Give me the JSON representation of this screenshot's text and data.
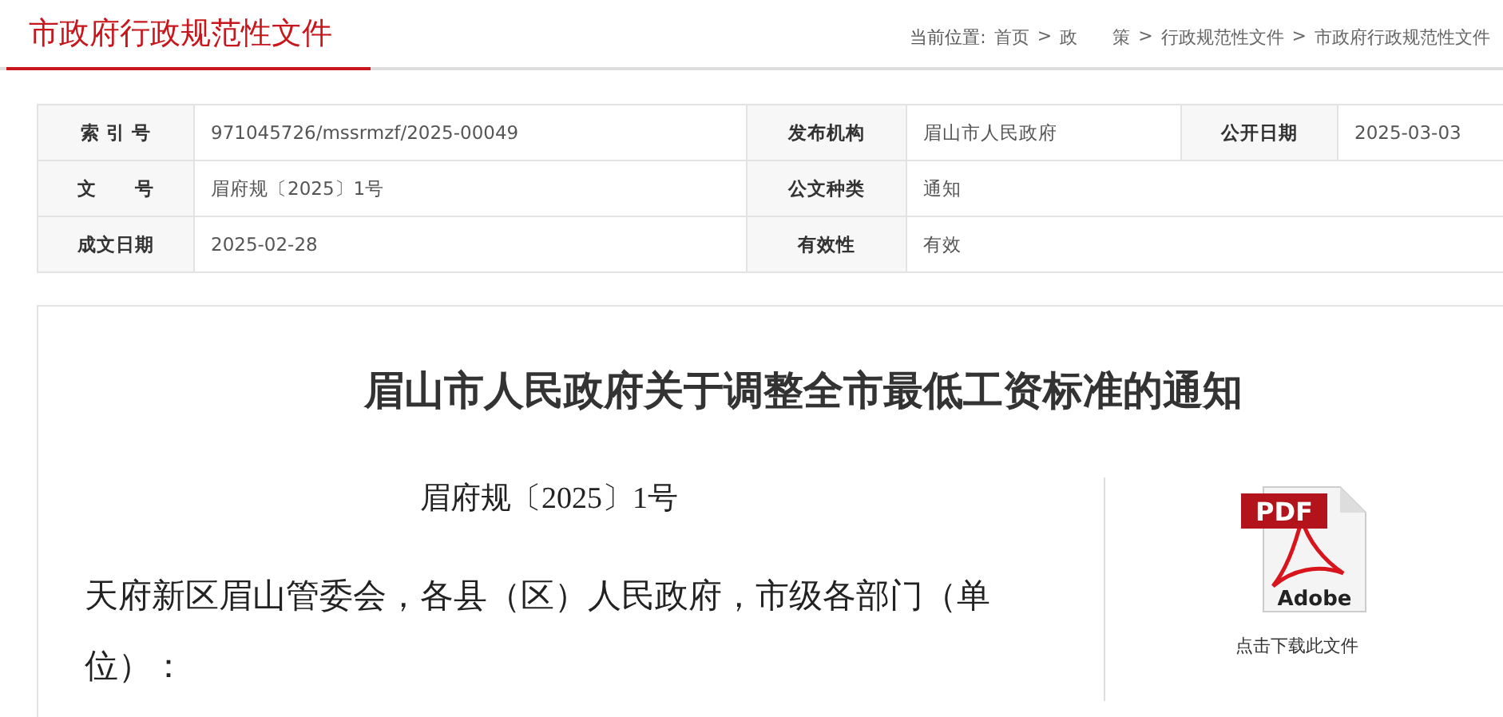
{
  "header": {
    "title": "市政府行政规范性文件",
    "breadcrumb": {
      "prefix": "当前位置:",
      "items": [
        "首页",
        "政　　策",
        "行政规范性文件",
        "市政府行政规范性文件"
      ],
      "separator": ">"
    }
  },
  "info_table": {
    "rows": [
      [
        {
          "label": "索 引 号",
          "value": "971045726/mssrmzf/2025-00049"
        },
        {
          "label": "发布机构",
          "value": "眉山市人民政府"
        },
        {
          "label": "公开日期",
          "value": "2025-03-03"
        }
      ],
      [
        {
          "label": "文　　号",
          "value": "眉府规〔2025〕1号"
        },
        {
          "label": "公文种类",
          "value": "通知"
        }
      ],
      [
        {
          "label": "成文日期",
          "value": "2025-02-28"
        },
        {
          "label": "有效性",
          "value": "有效"
        }
      ]
    ]
  },
  "document": {
    "title": "眉山市人民政府关于调整全市最低工资标准的通知",
    "doc_number": "眉府规〔2025〕1号",
    "salutation": "天府新区眉山管委会，各县（区）人民政府，市级各部门（单位）：",
    "download": {
      "badge": "PDF",
      "brand": "Adobe",
      "caption": "点击下载此文件"
    }
  }
}
